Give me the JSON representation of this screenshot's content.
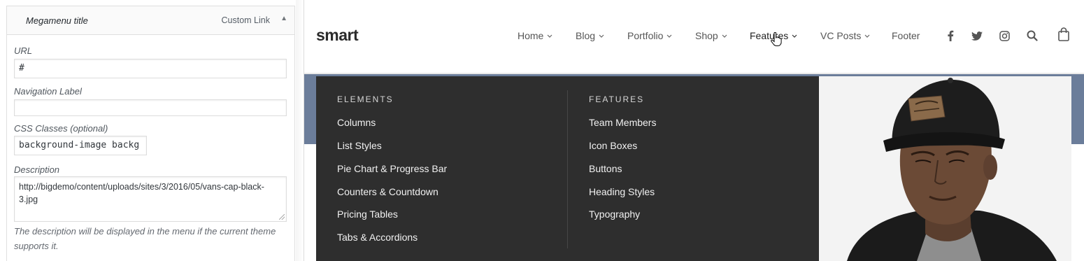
{
  "admin": {
    "item_title": "Megamenu title",
    "item_type": "Custom Link",
    "toggle_icon": "triangle-up-icon",
    "url_label": "URL",
    "url_value": "#",
    "nav_label_label": "Navigation Label",
    "nav_label_value": "",
    "css_label": "CSS Classes (optional)",
    "css_value": "background-image backg",
    "desc_label": "Description",
    "desc_value": "http://bigdemo/content/uploads/sites/3/2016/05/vans-cap-black-3.jpg",
    "desc_help": "The description will be displayed in the menu if the current theme supports it."
  },
  "site": {
    "logo": "smart",
    "nav": [
      {
        "label": "Home",
        "dropdown": true
      },
      {
        "label": "Blog",
        "dropdown": true
      },
      {
        "label": "Portfolio",
        "dropdown": true
      },
      {
        "label": "Shop",
        "dropdown": true
      },
      {
        "label": "Features",
        "dropdown": true,
        "active": true
      },
      {
        "label": "VC Posts",
        "dropdown": true
      },
      {
        "label": "Footer",
        "dropdown": false
      }
    ],
    "icons": [
      "facebook-icon",
      "twitter-icon",
      "instagram-icon",
      "search-icon",
      "shopping-bag-icon"
    ],
    "megamenu": {
      "columns": [
        {
          "title": "ELEMENTS",
          "links": [
            "Columns",
            "List Styles",
            "Pie Chart & Progress Bar",
            "Counters & Countdown",
            "Pricing Tables",
            "Tabs & Accordions"
          ]
        },
        {
          "title": "FEATURES",
          "links": [
            "Team Members",
            "Icon Boxes",
            "Buttons",
            "Heading Styles",
            "Typography"
          ]
        }
      ],
      "promo_image_icon": "man-in-cap-photo"
    },
    "colors": {
      "mega_bg": "#2e2e2e",
      "hero_band": "#6b7d9a",
      "cap_patch": "#8a6a4a"
    }
  }
}
